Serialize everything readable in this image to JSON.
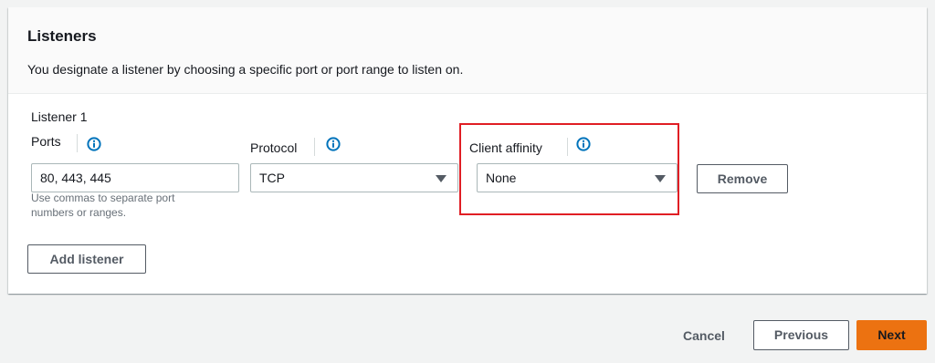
{
  "panel": {
    "title": "Listeners",
    "description": "You designate a listener by choosing a specific port or port range to listen on."
  },
  "listener": {
    "title": "Listener 1",
    "ports": {
      "label": "Ports",
      "value": "80, 443, 445",
      "hint": "Use commas to separate port numbers or ranges.",
      "info_icon": "info-icon"
    },
    "protocol": {
      "label": "Protocol",
      "selected": "TCP",
      "info_icon": "info-icon"
    },
    "client_affinity": {
      "label": "Client affinity",
      "selected": "None",
      "info_icon": "info-icon"
    },
    "remove_label": "Remove"
  },
  "add_listener_label": "Add listener",
  "footer": {
    "cancel_label": "Cancel",
    "previous_label": "Previous",
    "next_label": "Next"
  },
  "colors": {
    "primary": "#ec7211",
    "info": "#0073bb",
    "highlight": "#e01e24"
  }
}
